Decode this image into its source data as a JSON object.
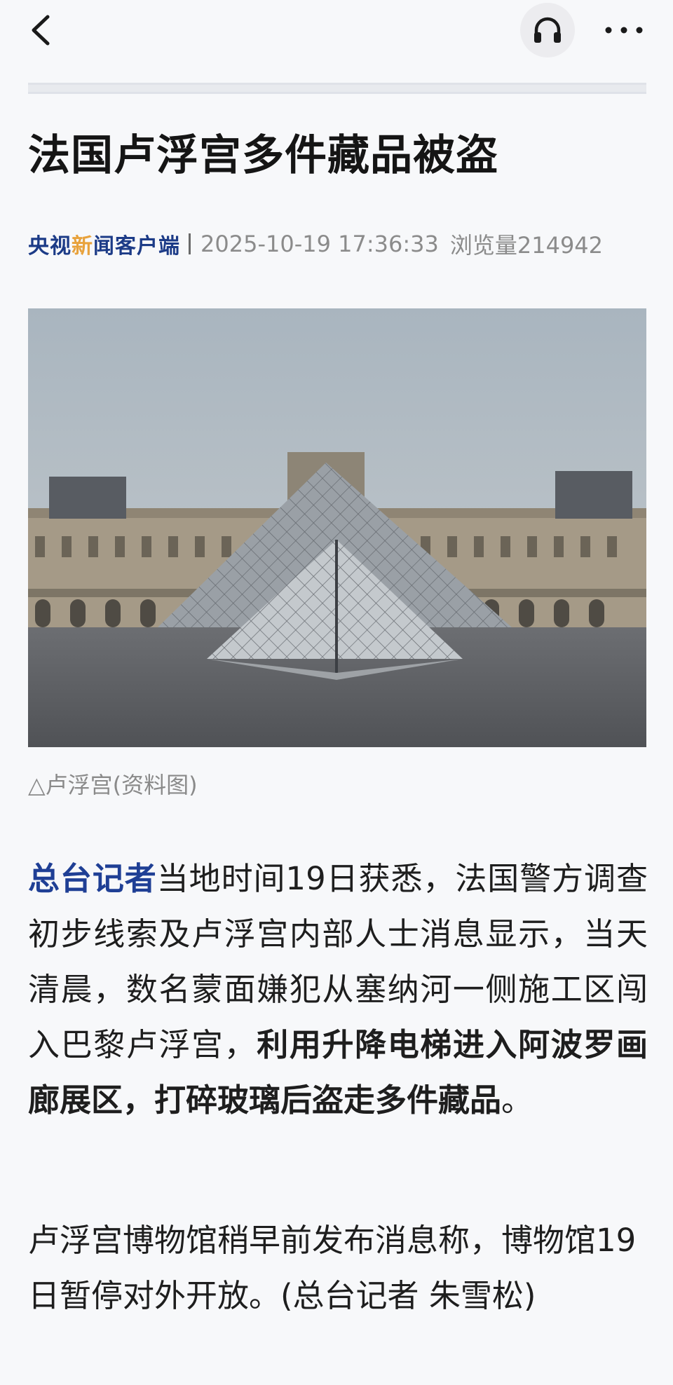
{
  "nav": {
    "back_icon": "chevron-left-icon",
    "audio_icon": "headphones-icon",
    "more_icon": "more-horizontal-icon"
  },
  "article": {
    "title": "法国卢浮宫多件藏品被盗",
    "source_part1": "央视",
    "source_highlight": "新",
    "source_part2": "闻客户端",
    "date": "2025-10-19 17:36:33",
    "views": "浏览量214942",
    "image_caption": "△卢浮宫(资料图)",
    "p1_lead": "总台记者",
    "p1_text": "当地时间19日获悉，法国警方调查初步线索及卢浮宫内部人士消息显示，当天清晨，数名蒙面嫌犯从塞纳河一侧施工区闯入巴黎卢浮宫，",
    "p1_bold": "利用升降电梯进入阿波罗画廊展区，打碎玻璃后盗走多件藏品",
    "p1_end": "。",
    "p2": "卢浮宫博物馆稍早前发布消息称，博物馆19日暂停对外开放。(总台记者 朱雪松)"
  },
  "colors": {
    "background": "#f7f8fa",
    "source_blue": "#1c3b87",
    "source_orange": "#e8a23c",
    "lead_blue": "#1f3f95",
    "meta_gray": "#8b8b8b"
  }
}
